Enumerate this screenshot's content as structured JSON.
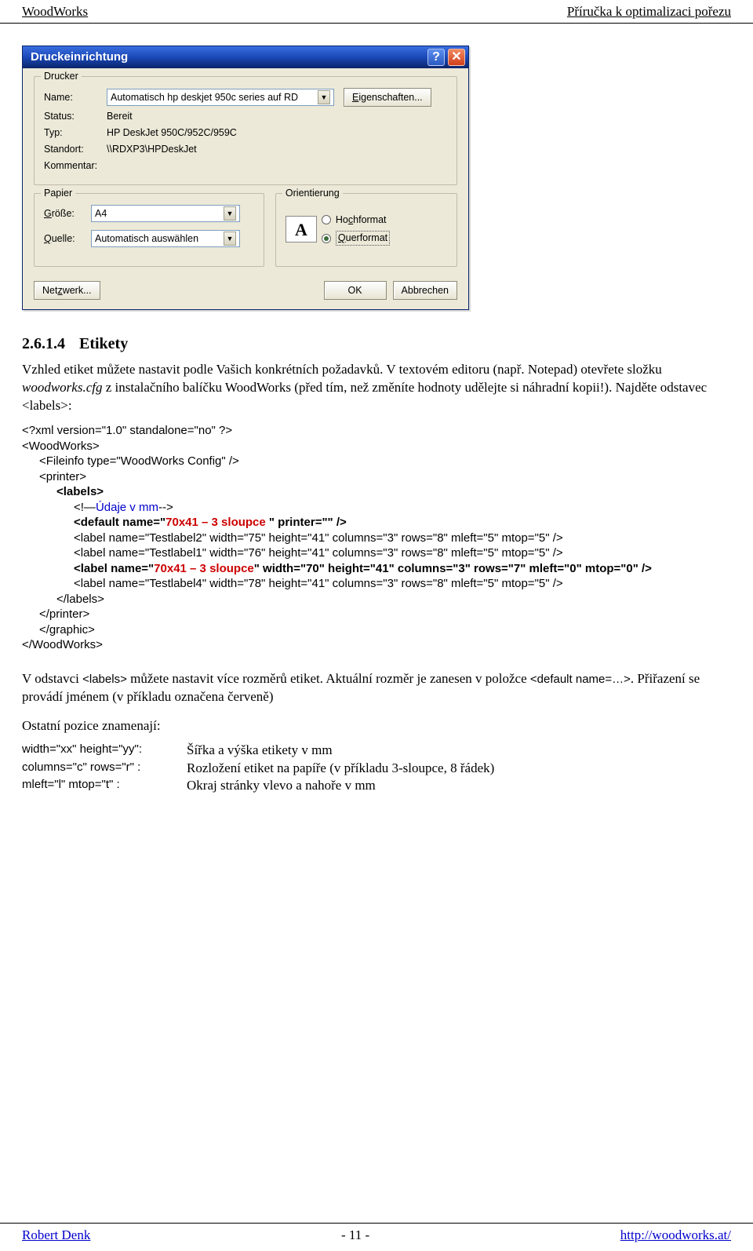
{
  "header": {
    "left": "WoodWorks",
    "right": "Příručka k optimalizaci pořezu"
  },
  "footer": {
    "left": "Robert Denk",
    "center": "- 11 -",
    "right": "http://woodworks.at/"
  },
  "dialog": {
    "title": "Druckeinrichtung",
    "group_printer": {
      "legend": "Drucker",
      "name_label": "Name:",
      "name_value": "Automatisch hp deskjet 950c series auf RD",
      "properties_btn": "Eigenschaften...",
      "status_label": "Status:",
      "status_value": "Bereit",
      "type_label": "Typ:",
      "type_value": "HP DeskJet 950C/952C/959C",
      "location_label": "Standort:",
      "location_value": "\\\\RDXP3\\HPDeskJet",
      "comment_label": "Kommentar:"
    },
    "group_paper": {
      "legend": "Papier",
      "size_label": "Größe:",
      "size_value": "A4",
      "source_label": "Quelle:",
      "source_value": "Automatisch auswählen"
    },
    "group_orient": {
      "legend": "Orientierung",
      "portrait_label": "Hochformat",
      "landscape_label": "Querformat",
      "icon_letter": "A"
    },
    "buttons": {
      "network": "Netzwerk...",
      "ok": "OK",
      "cancel": "Abbrechen"
    }
  },
  "section": {
    "number": "2.6.1.4",
    "title": "Etikety",
    "para1_a": "Vzhled etiket můžete nastavit podle Vašich konkrétních požadavků. V textovém editoru (např. Notepad) otevřete složku ",
    "para1_b": "woodworks.cfg",
    "para1_c": " z instalačního balíčku WoodWorks (před tím, než změníte hodnoty udělejte si náhradní kopii!). Najděte odstavec <labels>:"
  },
  "code": {
    "l1": "<?xml version=\"1.0\" standalone=\"no\" ?>",
    "l2": "<WoodWorks>",
    "l3": "<Fileinfo type=\"WoodWorks Config\" />",
    "l4": "<printer>",
    "l5": "<labels>",
    "l6a": "<!—",
    "l6b": "Údaje v mm",
    "l6c": "-->",
    "l7a": "<default name=\"",
    "l7b": "70x41 – 3 sloupce ",
    "l7c": "\" printer=\"\" />",
    "l8": "<label name=\"Testlabel2\" width=\"75\" height=\"41\" columns=\"3\" rows=\"8\" mleft=\"5\" mtop=\"5\" />",
    "l9": "<label name=\"Testlabel1\" width=\"76\" height=\"41\" columns=\"3\" rows=\"8\" mleft=\"5\" mtop=\"5\" />",
    "l10a": "<label name=\"",
    "l10b": "70x41 – 3 sloupce",
    "l10c": "\" width=\"70\" height=\"41\" columns=\"3\" rows=\"7\" mleft=\"0\" mtop=\"0\" />",
    "l11": "<label name=\"Testlabel4\" width=\"78\" height=\"41\" columns=\"3\" rows=\"8\" mleft=\"5\" mtop=\"5\" />",
    "l12": "</labels>",
    "l13": "</printer>",
    "l14": "</graphic>",
    "l15": "</WoodWorks>"
  },
  "after": {
    "para2": "V odstavci <labels> můžete nastavit více rozměrů etiket. Aktuální rozměr je zanesen v položce <default name=…>. Přiřazení se provádí jménem (v příkladu označena červeně)",
    "para3": "Ostatní pozice znamenají:",
    "defs": {
      "k1": "width=\"xx\" height=\"yy\":",
      "v1": "Šířka a výška etikety v mm",
      "k2": "columns=\"c\" rows=\"r\" :",
      "v2": "Rozložení etiket na papíře (v příkladu  3-sloupce, 8 řádek)",
      "k3": "mleft=\"l\" mtop=\"t\" :",
      "v3": "Okraj stránky vlevo a nahoře v mm"
    }
  }
}
